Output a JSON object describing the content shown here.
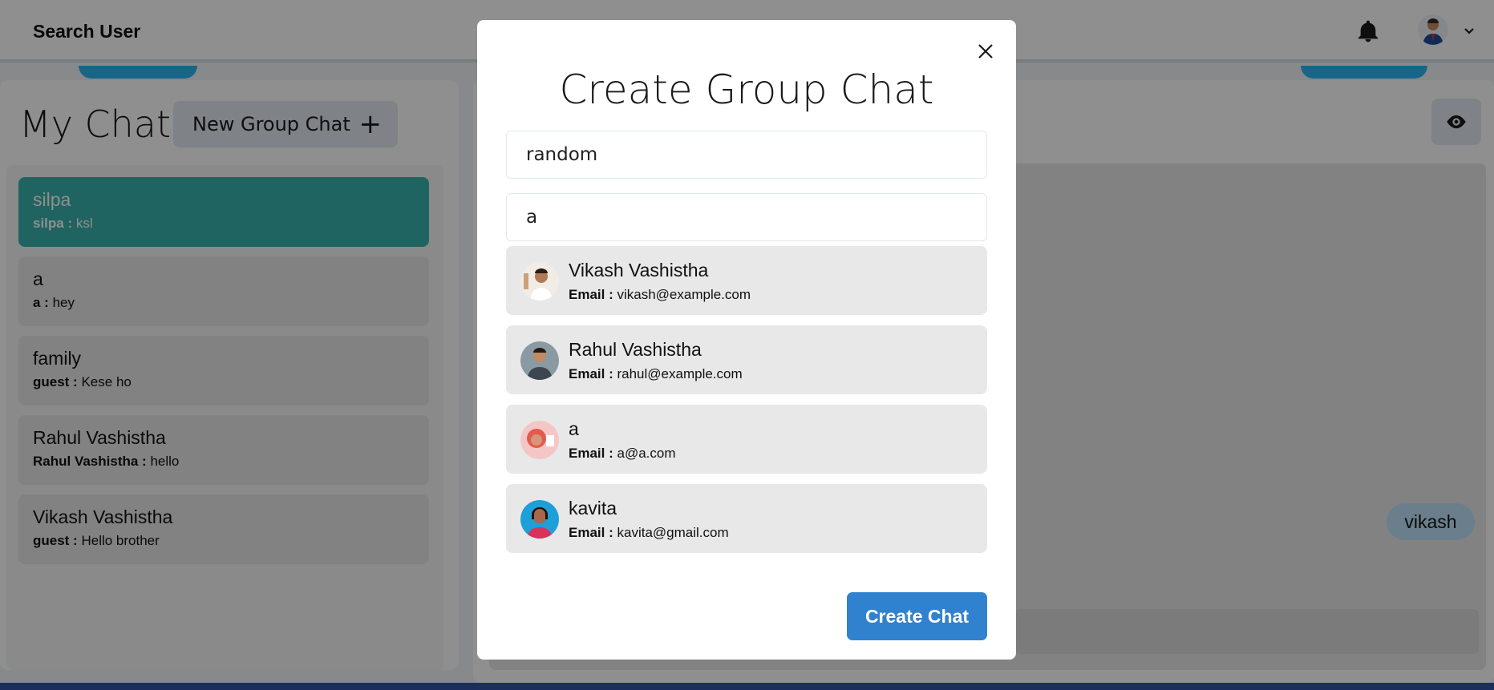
{
  "header": {
    "search_label": "Search User"
  },
  "sidebar": {
    "title": "My Chats",
    "new_group_label": "New Group Chat",
    "new_group_icon": "plus-icon",
    "chats": [
      {
        "name": "silpa",
        "sender": "silpa :",
        "message": "ksl",
        "active": true
      },
      {
        "name": "a",
        "sender": "a :",
        "message": "hey",
        "active": false
      },
      {
        "name": "family",
        "sender": "guest :",
        "message": "Kese ho",
        "active": false
      },
      {
        "name": "Rahul Vashistha",
        "sender": "Rahul Vashistha :",
        "message": "hello",
        "active": false
      },
      {
        "name": "Vikash Vashistha",
        "sender": "guest :",
        "message": "Hello brother",
        "active": false
      }
    ]
  },
  "chat_panel": {
    "bubble": "vikash",
    "view_icon": "eye-icon"
  },
  "modal": {
    "title": "Create Group Chat",
    "close_icon": "close-icon",
    "chat_name_value": "random",
    "search_value": "a",
    "email_label": "Email :",
    "results": [
      {
        "name": "Vikash Vashistha",
        "email": "vikash@example.com"
      },
      {
        "name": "Rahul Vashistha",
        "email": "rahul@example.com"
      },
      {
        "name": "a",
        "email": "a@a.com"
      },
      {
        "name": "kavita",
        "email": "kavita@gmail.com"
      }
    ],
    "create_label": "Create Chat"
  },
  "colors": {
    "accent_teal": "#38b2ac",
    "primary_blue": "#3182ce"
  }
}
